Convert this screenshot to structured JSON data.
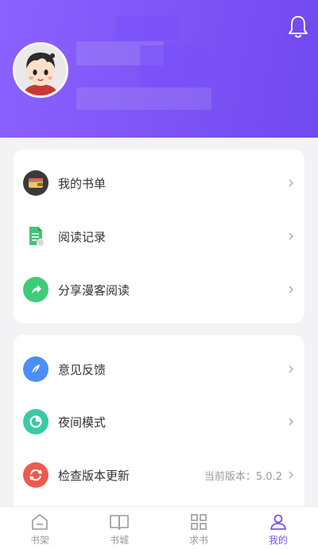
{
  "header": {
    "bell_icon": "bell-icon",
    "avatar_icon": "cartoon-avatar"
  },
  "menu_group_1": [
    {
      "label": "我的书单",
      "icon": "wallet-icon",
      "color": "#3a3a3a"
    },
    {
      "label": "阅读记录",
      "icon": "document-icon",
      "color": "#46c27a"
    },
    {
      "label": "分享漫客阅读",
      "icon": "share-icon",
      "color": "#3fcc7a"
    }
  ],
  "menu_group_2": [
    {
      "label": "意见反馈",
      "icon": "feather-icon",
      "color": "#4b8ef5"
    },
    {
      "label": "夜间模式",
      "icon": "moon-icon",
      "color": "#3bc9a5"
    },
    {
      "label": "检查版本更新",
      "icon": "refresh-icon",
      "color": "#ef5a4f",
      "extra": "当前版本：5.0.2"
    }
  ],
  "tabbar": {
    "tabs": [
      {
        "label": "书架",
        "icon": "bookshelf-icon",
        "active": false
      },
      {
        "label": "书城",
        "icon": "book-icon",
        "active": false
      },
      {
        "label": "求书",
        "icon": "grid-icon",
        "active": false
      },
      {
        "label": "我的",
        "icon": "person-icon",
        "active": true
      }
    ],
    "active_color": "#7a50f5",
    "inactive_color": "#9a9a9a"
  }
}
